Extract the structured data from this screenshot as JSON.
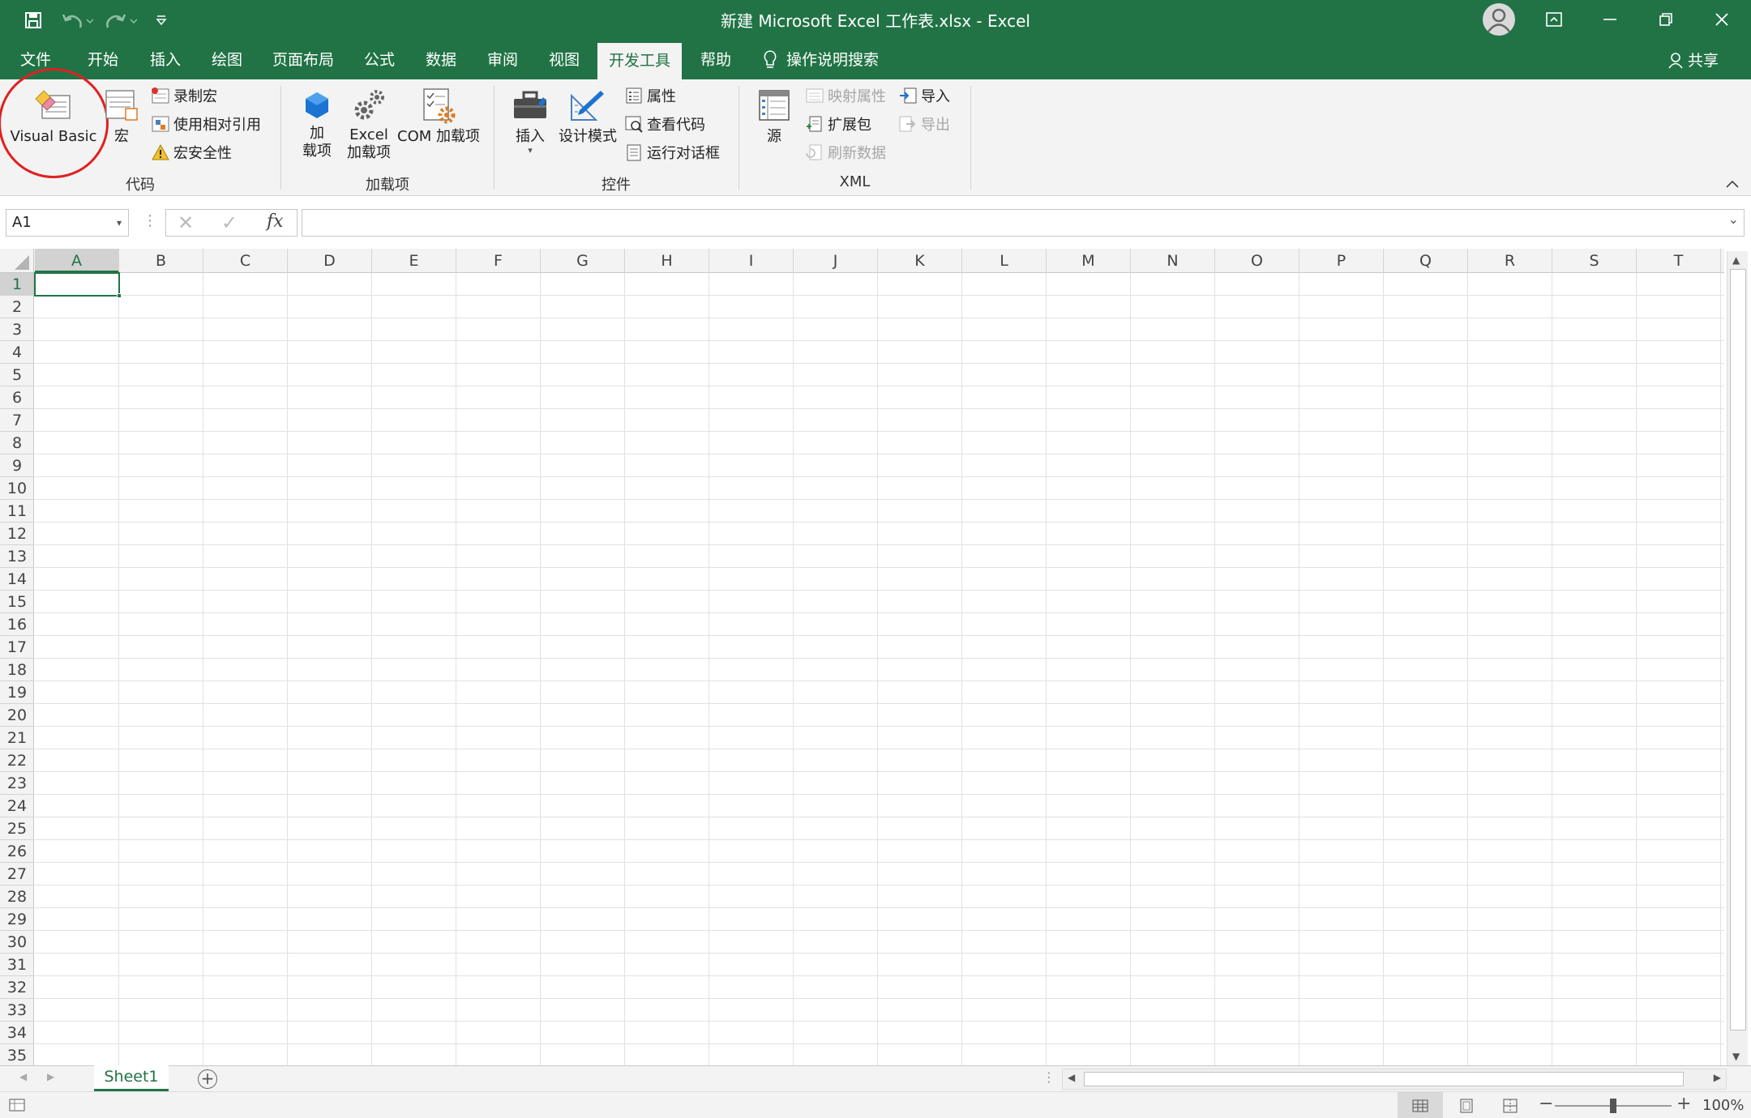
{
  "window": {
    "title": "新建 Microsoft Excel 工作表.xlsx  -  Excel"
  },
  "menu": {
    "tabs": [
      "文件",
      "开始",
      "插入",
      "绘图",
      "页面布局",
      "公式",
      "数据",
      "审阅",
      "视图",
      "开发工具",
      "帮助"
    ],
    "active_tab": "开发工具",
    "tell_me": "操作说明搜索",
    "share": "共享"
  },
  "ribbon": {
    "code": {
      "label": "代码",
      "visual_basic": "Visual Basic",
      "macros": "宏",
      "record_macro": "录制宏",
      "relative_refs": "使用相对引用",
      "macro_security": "宏安全性"
    },
    "addins": {
      "label": "加载项",
      "addins_line1": "加",
      "addins_line2": "载项",
      "excel_line1": "Excel",
      "excel_line2": "加载项",
      "com": "COM 加载项"
    },
    "controls": {
      "label": "控件",
      "insert": "插入",
      "design_mode": "设计模式",
      "properties": "属性",
      "view_code": "查看代码",
      "run_dialog": "运行对话框"
    },
    "xml": {
      "label": "XML",
      "source": "源",
      "map_properties": "映射属性",
      "expansion_packs": "扩展包",
      "refresh_data": "刷新数据",
      "import": "导入",
      "export": "导出"
    }
  },
  "formula_bar": {
    "name_box": "A1",
    "formula": ""
  },
  "grid": {
    "columns": [
      "A",
      "B",
      "C",
      "D",
      "E",
      "F",
      "G",
      "H",
      "I",
      "J",
      "K",
      "L",
      "M",
      "N",
      "O",
      "P",
      "Q",
      "R",
      "S",
      "T"
    ],
    "rows": [
      "1",
      "2",
      "3",
      "4",
      "5",
      "6",
      "7",
      "8",
      "9",
      "10",
      "11",
      "12",
      "13",
      "14",
      "15",
      "16",
      "17",
      "18",
      "19",
      "20",
      "21",
      "22",
      "23",
      "24",
      "25",
      "26",
      "27",
      "28",
      "29",
      "30",
      "31",
      "32",
      "33",
      "34",
      "35"
    ],
    "active_cell": "A1"
  },
  "sheets": {
    "tabs": [
      "Sheet1"
    ],
    "active": "Sheet1"
  },
  "status": {
    "zoom": "100%",
    "zoom_level": 1.0
  },
  "colors": {
    "brand": "#217346",
    "annotation": "#e02020"
  }
}
